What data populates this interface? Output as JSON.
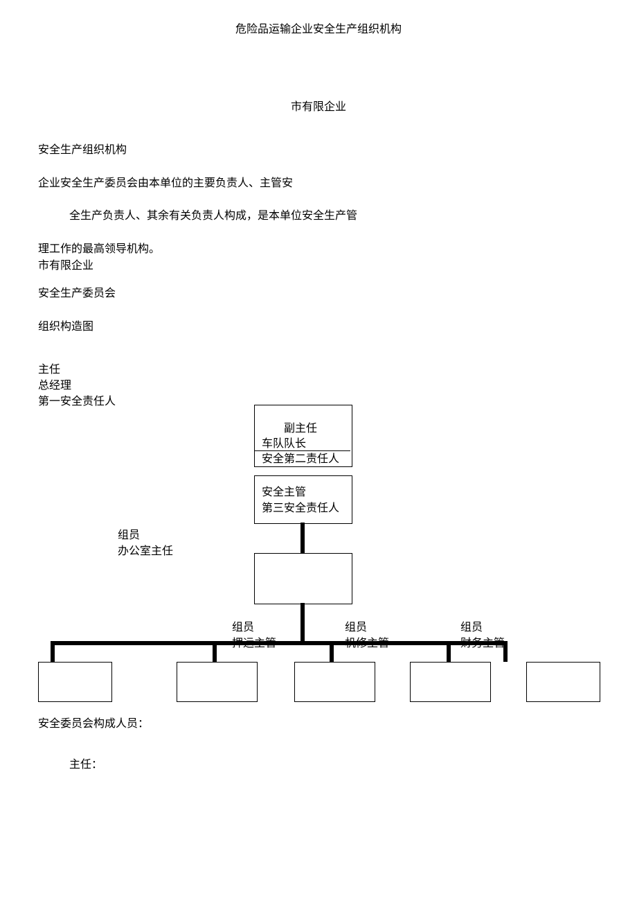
{
  "header": {
    "title": "危险品运输企业安全生产组织机构"
  },
  "subtitle": "市有限企业",
  "text": {
    "p1": "安全生产组织机构",
    "p2": "企业安全生产委员会由本单位的主要负责人、主管安",
    "p3": "全生产负责人、其余有关负责人构成，是本单位安全生产管",
    "p4": "理工作的最高领导机构。",
    "p5": "市有限企业",
    "p6": "安全生产委员会",
    "p7": "组织构造图",
    "p8": "主任",
    "p9": "总经理",
    "p10": "第一安全责任人"
  },
  "org": {
    "box1": {
      "l1": "副主任",
      "l2": "车队队长",
      "l3": "安全第二责任人"
    },
    "box2": {
      "l1": "安全主管",
      "l2": "第三安全责任人"
    },
    "side": {
      "l1": "组员",
      "l2": "办公室主任"
    },
    "m1": {
      "l1": "组员",
      "l2": "押运主管"
    },
    "m2": {
      "l1": "组员",
      "l2": "机修主管"
    },
    "m3": {
      "l1": "组员",
      "l2": "财务主管"
    }
  },
  "footer": {
    "f1": "安全委员会构成人员：",
    "f2": "主任："
  }
}
